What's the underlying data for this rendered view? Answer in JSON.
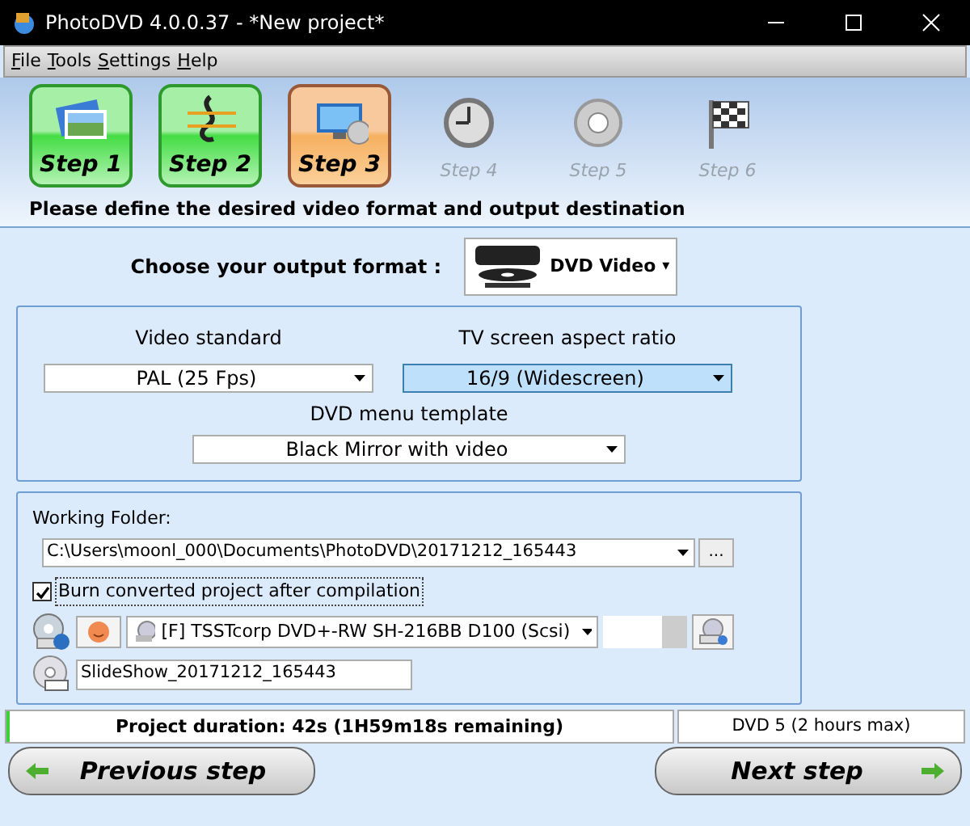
{
  "window": {
    "title": "PhotoDVD 4.0.0.37 - *New project*"
  },
  "menu": [
    {
      "label": "File"
    },
    {
      "label": "Tools"
    },
    {
      "label": "Settings"
    },
    {
      "label": "Help"
    }
  ],
  "steps": [
    {
      "label": "Step 1",
      "completed": true,
      "selected": false
    },
    {
      "label": "Step 2",
      "completed": true,
      "selected": false
    },
    {
      "label": "Step 3",
      "completed": false,
      "selected": true
    },
    {
      "label": "Step 4",
      "completed": false,
      "selected": false
    },
    {
      "label": "Step 5",
      "completed": false,
      "selected": false
    },
    {
      "label": "Step 6",
      "completed": false,
      "selected": false
    }
  ],
  "instruction": "Please define the desired video format and output destination",
  "format": {
    "label": "Choose your output format :",
    "value": "DVD Video",
    "caret": "▾"
  },
  "video_standard": {
    "label": "Video standard",
    "value": "PAL (25 Fps)"
  },
  "aspect_ratio": {
    "label": "TV screen aspect ratio",
    "value": "16/9 (Widescreen)",
    "focused": true
  },
  "menu_template": {
    "label": "DVD menu template",
    "value": "Black Mirror with video"
  },
  "working_folder": {
    "label": "Working Folder:",
    "value": "C:\\Users\\moonl_000\\Documents\\PhotoDVD\\20171212_165443",
    "browse": "..."
  },
  "burn": {
    "label": "Burn converted project after compilation",
    "checked": true
  },
  "drive": {
    "value": "[F] TSSTcorp DVD+-RW SH-216BB D100 (Scsi)"
  },
  "disc_label": {
    "value": "SlideShow_20171212_165443"
  },
  "status": {
    "duration": "Project duration: 42s (1H59m18s remaining)",
    "level": 0.005,
    "capacity": "DVD 5 (2 hours max)"
  },
  "nav": {
    "previous": "Previous step",
    "next": "Next step"
  }
}
